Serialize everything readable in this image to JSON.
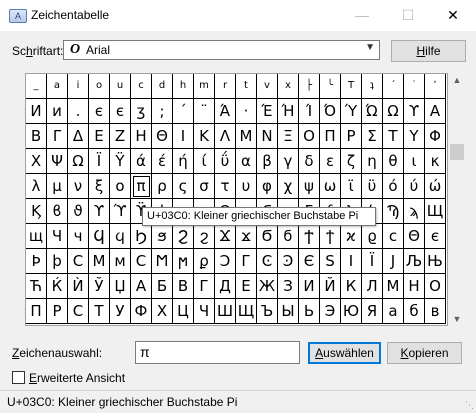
{
  "window": {
    "title": "Zeichentabelle",
    "minimize": "—",
    "maximize": "☐",
    "close": "✕"
  },
  "font": {
    "label": "Schriftart:",
    "icon": "O",
    "name": "Arial",
    "help_button": "Hilfe"
  },
  "grid": {
    "rows": [
      [
        "_",
        "a",
        "i",
        "o",
        "u",
        "c",
        "d",
        "h",
        "m",
        "r",
        "t",
        "v",
        "x",
        "├",
        "╰",
        "T",
        "ʇ",
        "´",
        "˙",
        "ʼ"
      ],
      [
        "И",
        "и",
        ".",
        "є",
        "є",
        "ʒ",
        ";",
        "´",
        "¨",
        "Ά",
        "·",
        "Έ",
        "Ή",
        "Ί",
        "Ό",
        "Ύ",
        "Ώ",
        "Ω",
        "ϒ",
        "Α"
      ],
      [
        "Β",
        "Γ",
        "Δ",
        "Ε",
        "Ζ",
        "Η",
        "Θ",
        "Ι",
        "Κ",
        "Λ",
        "Μ",
        "Ν",
        "Ξ",
        "Ο",
        "Π",
        "Ρ",
        "Σ",
        "Τ",
        "Υ",
        "Φ"
      ],
      [
        "Χ",
        "Ψ",
        "Ω",
        "Ϊ",
        "Ϋ",
        "ά",
        "έ",
        "ή",
        "ί",
        "ΰ",
        "α",
        "β",
        "γ",
        "δ",
        "ε",
        "ζ",
        "η",
        "θ",
        "ι",
        "κ"
      ],
      [
        "λ",
        "μ",
        "ν",
        "ξ",
        "ο",
        "π",
        "ρ",
        "ς",
        "σ",
        "τ",
        "υ",
        "φ",
        "χ",
        "ψ",
        "ω",
        "ϊ",
        "ϋ",
        "ό",
        "ύ",
        "ώ"
      ],
      [
        "Ϗ",
        "ϐ",
        "ϑ",
        "ϒ",
        "ϓ",
        "ϔ",
        "ϕ",
        "ϖ",
        "ϗ",
        "Ϙ",
        "ϙ",
        "Ϛ",
        "ϛ",
        "Ϝ",
        "ϝ",
        "Ϟ",
        "ϟ",
        "Ϡ",
        "ϡ",
        "Щ"
      ],
      [
        "щ",
        "Ч",
        "ч",
        "Ϥ",
        "ϥ",
        "Ϧ",
        "ϧ",
        "Ϩ",
        "ϩ",
        "Ϫ",
        "ϫ",
        "Ϭ",
        "ϭ",
        "Ϯ",
        "ϯ",
        "ϰ",
        "ϱ",
        "ϲ",
        "Θ",
        "є"
      ],
      [
        "Þ",
        "þ",
        "С",
        "М",
        "м",
        "Ϲ",
        "Ϻ",
        "ϻ",
        "ϼ",
        "Ͻ",
        "Г",
        "Ͼ",
        "Ͽ",
        "Є",
        "Ѕ",
        "І",
        "Ї",
        "Ј",
        "Љ",
        "Њ"
      ],
      [
        "Ћ",
        "Ќ",
        "Ѝ",
        "Ў",
        "Џ",
        "А",
        "Б",
        "В",
        "Г",
        "Д",
        "Е",
        "Ж",
        "З",
        "И",
        "Й",
        "К",
        "Л",
        "М",
        "Н",
        "О"
      ],
      [
        "П",
        "Р",
        "С",
        "Т",
        "У",
        "Ф",
        "Х",
        "Ц",
        "Ч",
        "Ш",
        "Щ",
        "Ъ",
        "Ы",
        "Ь",
        "Э",
        "Ю",
        "Я",
        "а",
        "б",
        "в"
      ]
    ],
    "selected_row": 4,
    "selected_col": 5
  },
  "tooltip": "U+03C0: Kleiner griechischer Buchstabe Pi",
  "selection": {
    "label": "Zeichenauswahl:",
    "value": "π",
    "select_button": "Auswählen",
    "copy_button": "Kopieren"
  },
  "advanced": {
    "label": "Erweiterte Ansicht",
    "checked": false
  },
  "status": "U+03C0: Kleiner griechischer Buchstabe Pi"
}
